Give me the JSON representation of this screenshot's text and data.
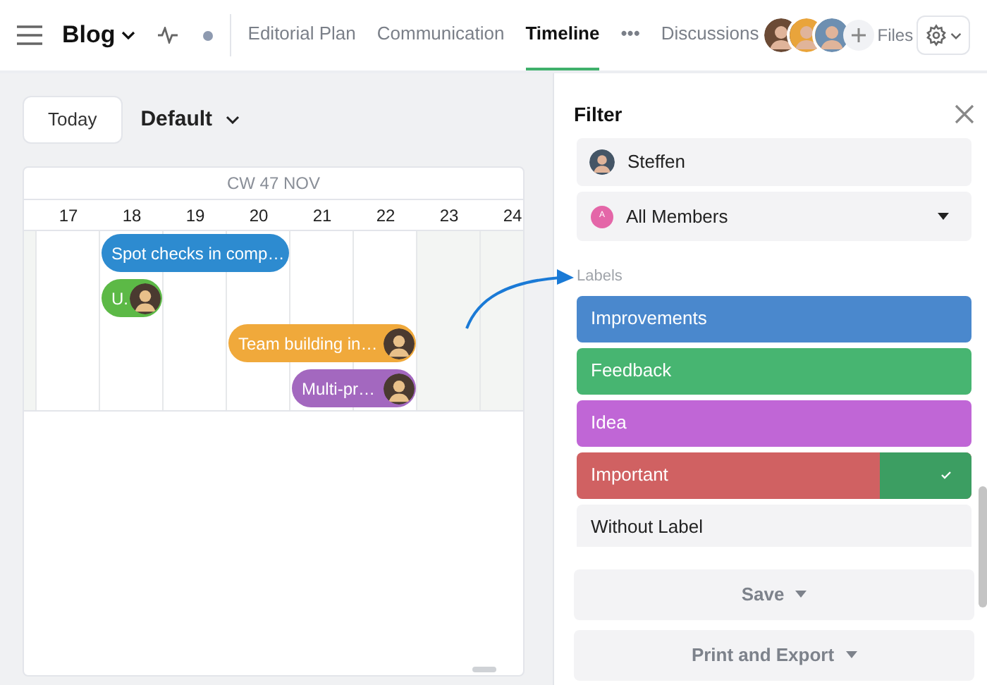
{
  "header": {
    "title": "Blog",
    "tabs": [
      {
        "label": "Editorial Plan",
        "selected": false
      },
      {
        "label": "Communication",
        "selected": false
      },
      {
        "label": "Timeline",
        "selected": true
      },
      {
        "label": "•••",
        "selected": false
      },
      {
        "label": "Discussions",
        "selected": false
      }
    ],
    "trailing_tab": {
      "label": "Files",
      "selected": false
    }
  },
  "toolbar": {
    "today": "Today",
    "view": "Default"
  },
  "timeline": {
    "week_label": "CW 47 NOV",
    "days": [
      {
        "label": "17",
        "weekend": false
      },
      {
        "label": "18",
        "weekend": false
      },
      {
        "label": "19",
        "weekend": false
      },
      {
        "label": "20",
        "weekend": false
      },
      {
        "label": "21",
        "weekend": false
      },
      {
        "label": "22",
        "weekend": false
      },
      {
        "label": "23",
        "weekend": true
      },
      {
        "label": "24",
        "weekend": true
      }
    ],
    "events": [
      {
        "title": "Spot checks in comp…",
        "color": "#2d8bd0",
        "assignee": false
      },
      {
        "title": "U.",
        "color": "#5cb946",
        "assignee": true
      },
      {
        "title": "Team building in…",
        "color": "#f0a93b",
        "assignee": true
      },
      {
        "title": "Multi-pr…",
        "color": "#a368bf",
        "assignee": true
      }
    ]
  },
  "filter": {
    "title": "Filter",
    "person": "Steffen",
    "members": {
      "initial": "A",
      "value": "All Members"
    },
    "labels_heading": "Labels",
    "labels": [
      {
        "name": "Improvements",
        "kind": "color",
        "color": "#4a88cd",
        "checked": false
      },
      {
        "name": "Feedback",
        "kind": "color",
        "color": "#47b571",
        "checked": false
      },
      {
        "name": "Idea",
        "kind": "color",
        "color": "#c066d6",
        "checked": false
      },
      {
        "name": "Important",
        "kind": "color",
        "color": "#d06162",
        "checked": true
      },
      {
        "name": "Without Label",
        "kind": "plain",
        "checked": false
      }
    ],
    "save": "Save",
    "print": "Print and Export"
  }
}
